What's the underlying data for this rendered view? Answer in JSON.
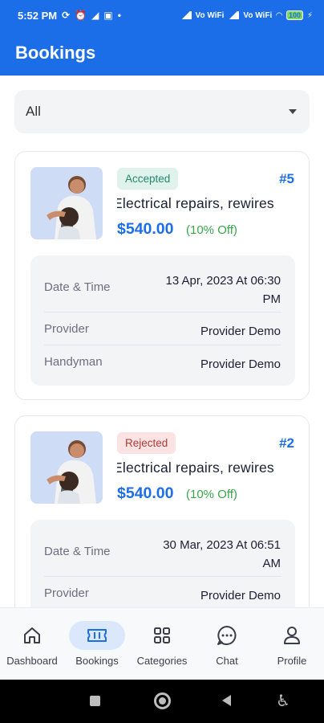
{
  "status_bar": {
    "time": "5:52 PM",
    "battery": "100",
    "network_label_1": "Vo WiFi",
    "network_label_2": "Vo WiFi"
  },
  "app_bar": {
    "title": "Bookings"
  },
  "filter": {
    "selected": "All"
  },
  "bookings": [
    {
      "status": "Accepted",
      "number": "#5",
      "service": "Electrical repairs, rewires",
      "price": "$540.00",
      "discount": "(10% Off)",
      "date_label": "Date & Time",
      "date_line1": "13 Apr, 2023 At 06:30",
      "date_line2": "PM",
      "provider_label": "Provider",
      "provider_value": "Provider Demo",
      "handyman_label": "Handyman",
      "handyman_value": "Provider Demo"
    },
    {
      "status": "Rejected",
      "number": "#2",
      "service": "Electrical repairs, rewires",
      "price": "$540.00",
      "discount": "(10% Off)",
      "date_label": "Date & Time",
      "date_line1": "30 Mar, 2023 At 06:51",
      "date_line2": "AM",
      "provider_label": "Provider",
      "provider_value": "Provider Demo"
    }
  ],
  "bottom_nav": [
    {
      "label": "Dashboard",
      "icon": "home-icon"
    },
    {
      "label": "Bookings",
      "icon": "ticket-icon",
      "active": true
    },
    {
      "label": "Categories",
      "icon": "grid-icon"
    },
    {
      "label": "Chat",
      "icon": "chat-icon"
    },
    {
      "label": "Profile",
      "icon": "profile-icon"
    }
  ],
  "colors": {
    "primary": "#1c6ee8",
    "accepted_bg": "#dff3ec",
    "accepted_text": "#26876b",
    "rejected_bg": "#fbe3e3",
    "rejected_text": "#b33a3a",
    "discount": "#3aa54b"
  }
}
